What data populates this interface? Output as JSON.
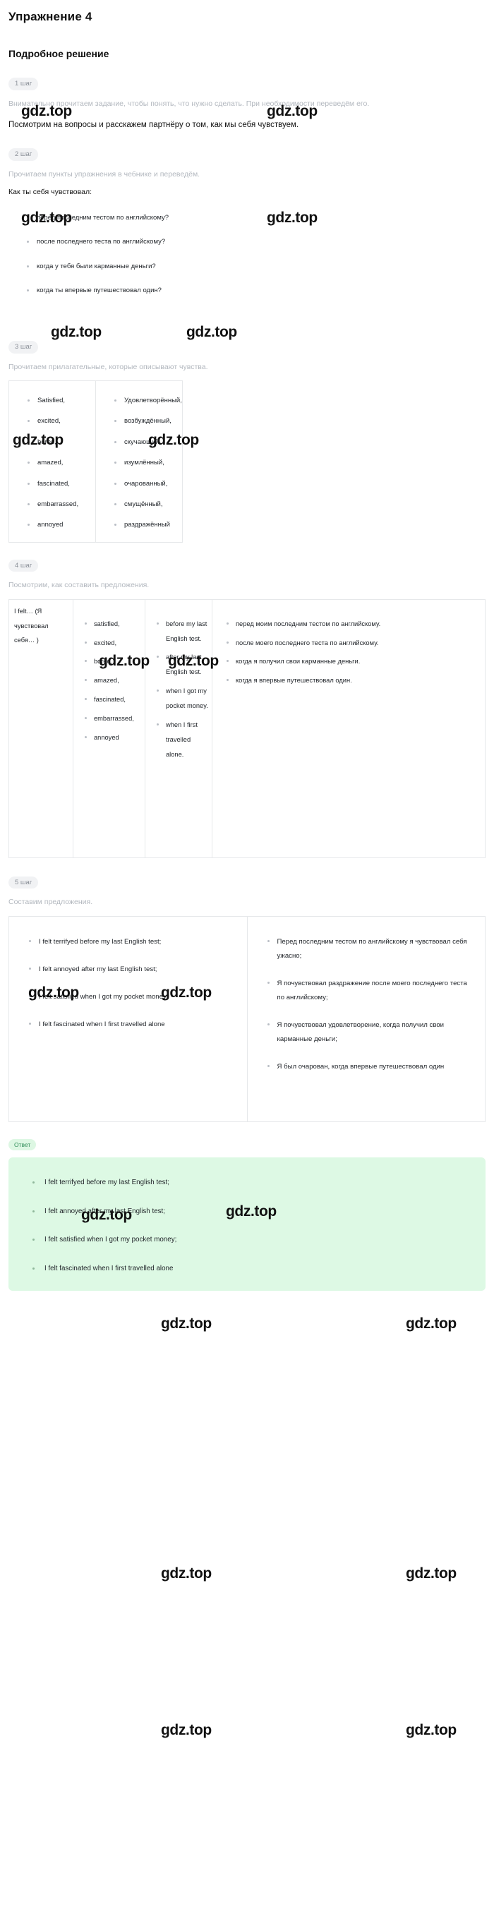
{
  "header": {
    "exercise_title": "Упражнение 4",
    "solution_title": "Подробное решение"
  },
  "watermark": {
    "text": "gdz.top"
  },
  "steps": [
    {
      "badge": "1 шаг",
      "note": "Внимательно прочитаем задание, чтобы понять, что нужно сделать. При необходимости переведём его.",
      "statement": "Посмотрим на вопросы и расскажем партнёру о том, как мы себя чувствуем."
    },
    {
      "badge": "2 шаг",
      "note": "Прочитаем пункты упражнения в чебнике и переведём.",
      "subhead": "Как ты себя чувствовал:",
      "questions": [
        "перед последним тестом по английскому?",
        "после последнего теста по английскому?",
        "когда у тебя были карманные деньги?",
        "когда ты впервые путешествовал один?"
      ]
    },
    {
      "badge": "3 шаг",
      "note": "Прочитаем прилагательные, которые описывают чувства.",
      "adjectives": {
        "english": [
          "Satisfied,",
          "excited,",
          "bored,",
          "amazed,",
          "fascinated,",
          "embarrassed,",
          "annoyed"
        ],
        "russian": [
          "Удовлетворённый,",
          "возбуждённый,",
          "скучающий,",
          "изумлённый,",
          "очарованный,",
          "смущённый,",
          "раздражённый"
        ]
      }
    },
    {
      "badge": "4 шаг",
      "note": "Посмотрим, как составить предложения.",
      "builder": {
        "col1_text": "I felt… (Я чувствовал себя… )",
        "col2": [
          "satisfied,",
          "excited,",
          "bored,",
          "amazed,",
          "fascinated,",
          "embarrassed,",
          "annoyed"
        ],
        "col3": [
          "before my last English test.",
          "after my last English test.",
          "when I got my pocket money.",
          "when I first travelled alone."
        ],
        "col4": [
          "перед моим последним тестом по английскому.",
          "после моего последнего теста по английскому.",
          "когда я получил свои карманные деньги.",
          "когда я впервые путешествовал один."
        ]
      }
    },
    {
      "badge": "5 шаг",
      "note": "Составим предложения.",
      "sentences": {
        "english": [
          "I felt terrifyed before my last English test;",
          "I felt annoyed after my last English test;",
          "I felt satisfied when I got my pocket money;",
          "I felt fascinated when I first travelled alone"
        ],
        "russian": [
          "Перед последним тестом по английскому я чувствовал себя ужасно;",
          "Я почувствовал раздражение после моего последнего теста по английскому;",
          "Я почувствовал удовлетворение, когда получил свои карманные деньги;",
          "Я был очарован, когда впервые путешествовал один"
        ]
      }
    }
  ],
  "answer": {
    "badge": "Ответ",
    "items": [
      "I felt terrifyed before my last English test;",
      "I felt annoyed after my last English test;",
      "I felt satisfied when I got my pocket money;",
      "I felt fascinated when I first travelled alone"
    ]
  },
  "colors": {
    "answer_bg": "#ddf9e4",
    "answer_badge_bg": "#ddf7e3",
    "answer_badge_text": "#2e8b57",
    "step_badge_bg": "#f1f2f4",
    "muted_text": "#b3b8bf",
    "border": "#e6e8ea"
  }
}
